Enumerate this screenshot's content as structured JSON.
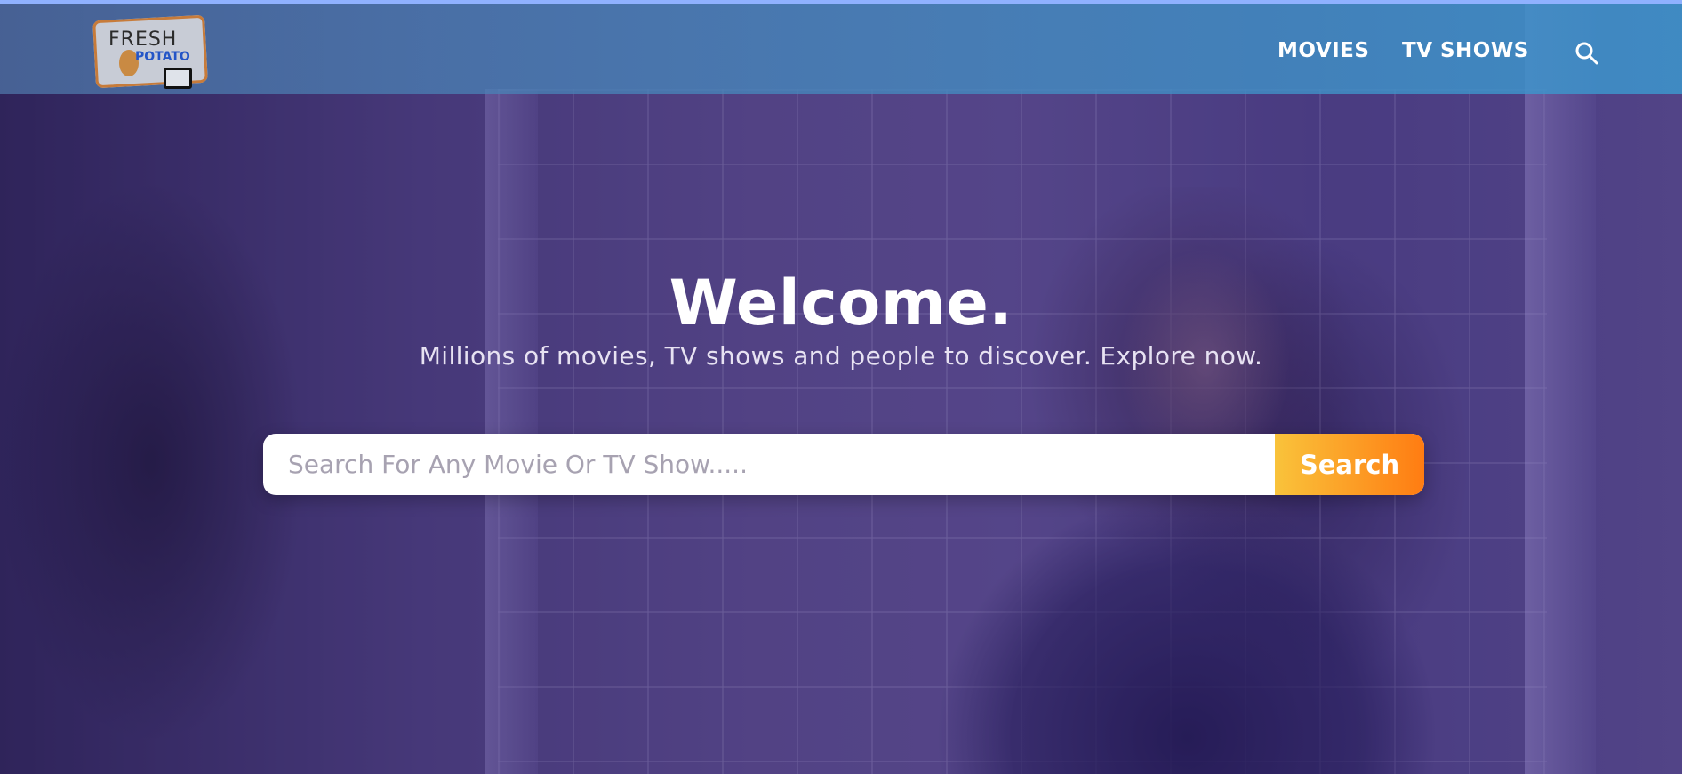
{
  "header": {
    "logo": {
      "line1": "FRESH",
      "line2": "POTATO"
    },
    "nav": [
      {
        "label": "MOVIES"
      },
      {
        "label": "TV SHOWS"
      }
    ],
    "search_icon": "search-icon"
  },
  "hero": {
    "title": "Welcome.",
    "subtitle": "Millions of movies, TV shows and people to discover. Explore now.",
    "search": {
      "placeholder": "Search For Any Movie Or TV Show.....",
      "value": "",
      "button_label": "Search"
    }
  },
  "colors": {
    "header": "#4a9fd0",
    "overlay": "#3c2878",
    "button_start": "#f9c33b",
    "button_end": "#ff7c12",
    "text": "#ffffff"
  }
}
